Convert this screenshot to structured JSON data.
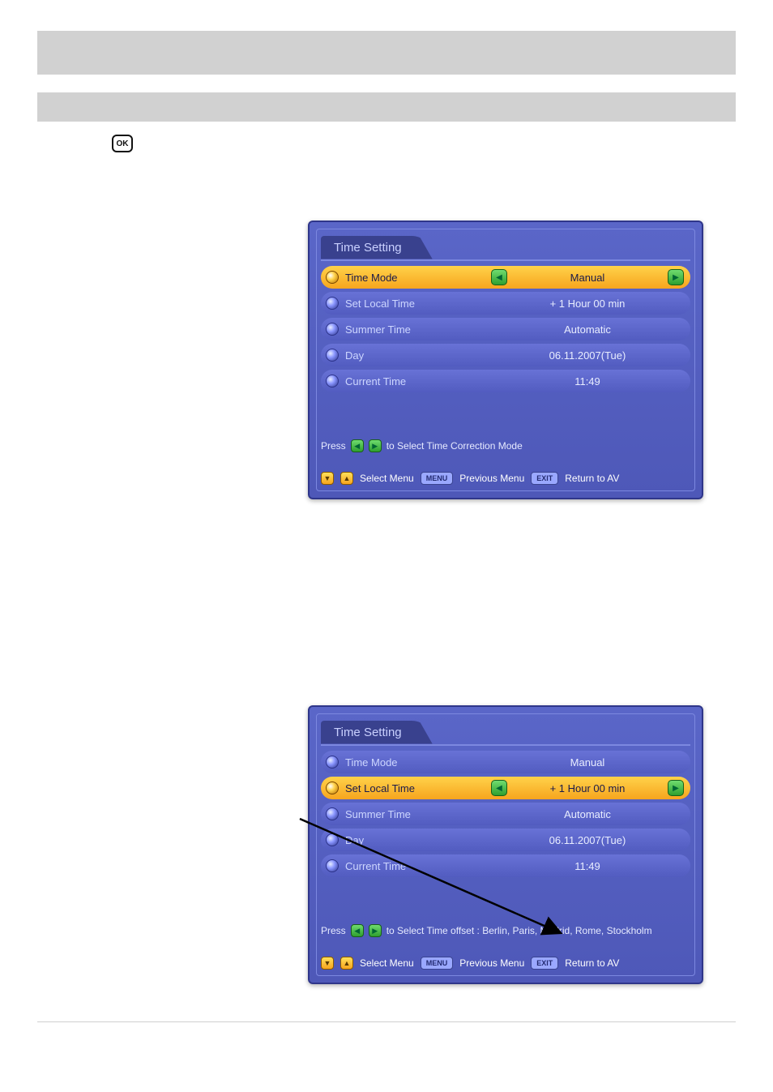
{
  "ok_label": "OK",
  "osd1": {
    "title": "Time Setting",
    "rows": [
      {
        "label": "Time Mode",
        "value": "Manual",
        "selected": true,
        "arrows": true
      },
      {
        "label": "Set Local Time",
        "value": "+ 1 Hour 00 min",
        "selected": false,
        "arrows": false
      },
      {
        "label": "Summer Time",
        "value": "Automatic",
        "selected": false,
        "arrows": false
      },
      {
        "label": "Day",
        "value": "06.11.2007(Tue)",
        "selected": false,
        "arrows": false
      },
      {
        "label": "Current Time",
        "value": "11:49",
        "selected": false,
        "arrows": false
      }
    ],
    "hint_prefix": "Press",
    "hint_suffix": "to Select Time Correction Mode",
    "footer": {
      "select": "Select Menu",
      "menu": "Previous Menu",
      "exit": "Return to AV",
      "menu_tag": "MENU",
      "exit_tag": "EXIT"
    }
  },
  "osd2": {
    "title": "Time Setting",
    "rows": [
      {
        "label": "Time Mode",
        "value": "Manual",
        "selected": false,
        "arrows": false
      },
      {
        "label": "Set Local Time",
        "value": "+ 1 Hour 00 min",
        "selected": true,
        "arrows": true
      },
      {
        "label": "Summer Time",
        "value": "Automatic",
        "selected": false,
        "arrows": false
      },
      {
        "label": "Day",
        "value": "06.11.2007(Tue)",
        "selected": false,
        "arrows": false
      },
      {
        "label": "Current Time",
        "value": "11:49",
        "selected": false,
        "arrows": false
      }
    ],
    "hint_prefix": "Press",
    "hint_suffix": "to Select Time offset : Berlin, Paris, Madrid, Rome, Stockholm",
    "footer": {
      "select": "Select Menu",
      "menu": "Previous Menu",
      "exit": "Return to AV",
      "menu_tag": "MENU",
      "exit_tag": "EXIT"
    }
  }
}
